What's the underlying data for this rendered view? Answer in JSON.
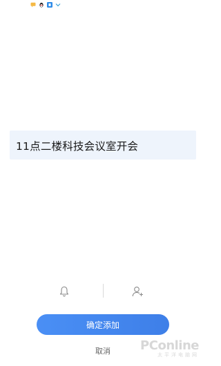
{
  "status_bar": {
    "icons": [
      "message-icon",
      "qq-penguin-icon",
      "app-badge-icon",
      "chevron-down-icon"
    ]
  },
  "reminder": {
    "text": "11点二楼科技会议室开会"
  },
  "toolbar": {
    "buttons": [
      "bell-icon",
      "add-person-icon"
    ]
  },
  "actions": {
    "confirm_label": "确定添加",
    "cancel_label": "取消"
  },
  "watermark": {
    "brand": "PConline",
    "tagline": "太平洋电脑网"
  },
  "colors": {
    "accent": "#3e7fe8",
    "card_bg": "#eef4fc",
    "text_primary": "#1a1a1a",
    "text_secondary": "#666666"
  }
}
